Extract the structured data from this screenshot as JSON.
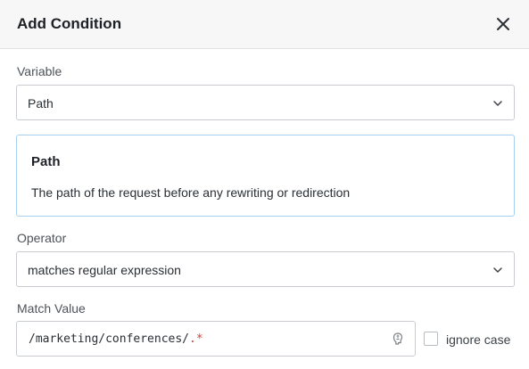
{
  "dialog": {
    "title": "Add Condition",
    "close_icon": "close-icon"
  },
  "variable": {
    "label": "Variable",
    "selected": "Path",
    "dropdown_icon": "chevron-down-icon"
  },
  "info": {
    "title": "Path",
    "description": "The path of the request before any rewriting or redirection"
  },
  "operator": {
    "label": "Operator",
    "selected": "matches regular expression",
    "dropdown_icon": "chevron-down-icon"
  },
  "match_value": {
    "label": "Match Value",
    "value_prefix": "/marketing/conferences/",
    "value_regex": ".*",
    "regex_icon": "regex-icon"
  },
  "ignore_case": {
    "label": "ignore case",
    "checked": false
  },
  "colors": {
    "header_bg": "#f7f7f7",
    "info_border": "#a9cfee",
    "regex_token": "#d43f3a"
  }
}
